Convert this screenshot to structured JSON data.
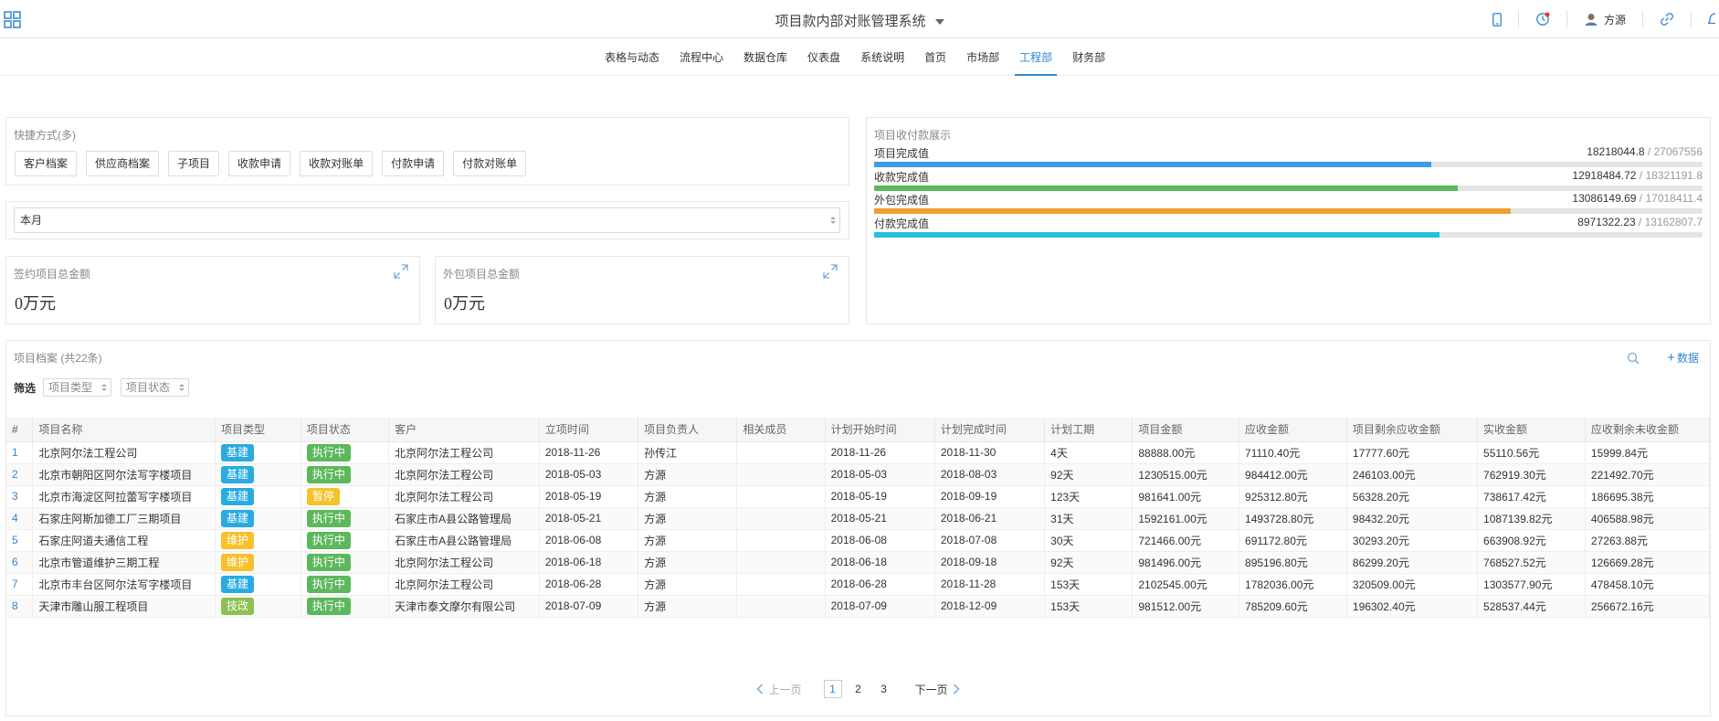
{
  "header": {
    "title": "项目款内部对账管理系统",
    "user_name": "方源"
  },
  "nav": {
    "tabs": [
      "表格与动态",
      "流程中心",
      "数据仓库",
      "仪表盘",
      "系统说明",
      "首页",
      "市场部",
      "工程部",
      "财务部"
    ],
    "active_tab": "工程部"
  },
  "shortcuts": {
    "title": "快捷方式(多)",
    "buttons": [
      "客户档案",
      "供应商档案",
      "子项目",
      "收款申请",
      "收款对账单",
      "付款申请",
      "付款对账单"
    ]
  },
  "period": {
    "value": "本月"
  },
  "kpis": [
    {
      "title": "签约项目总金额",
      "value": "0万元"
    },
    {
      "title": "外包项目总金额",
      "value": "0万元"
    }
  ],
  "progress": {
    "title": "项目收付款展示",
    "items": [
      {
        "label": "项目完成值",
        "value": "18218044.8",
        "total": "27067556",
        "fraction": 0.673,
        "color": "#3b9ce8"
      },
      {
        "label": "收款完成值",
        "value": "12918484.72",
        "total": "18321191.8",
        "fraction": 0.705,
        "color": "#5cb85c"
      },
      {
        "label": "外包完成值",
        "value": "13086149.69",
        "total": "17018411.4",
        "fraction": 0.769,
        "color": "#f0a030"
      },
      {
        "label": "付款完成值",
        "value": "8971322.23",
        "total": "13162807.7",
        "fraction": 0.682,
        "color": "#26c0d8"
      }
    ]
  },
  "table": {
    "title": "项目档案 (共22条)",
    "add_label": "数据",
    "filter_label": "筛选",
    "filters": [
      "项目类型",
      "项目状态"
    ],
    "columns": [
      "#",
      "项目名称",
      "项目类型",
      "项目状态",
      "客户",
      "立项时间",
      "项目负责人",
      "相关成员",
      "计划开始时间",
      "计划完成时间",
      "计划工期",
      "项目金额",
      "应收金额",
      "项目剩余应收金额",
      "实收金额",
      "应收剩余未收金额"
    ],
    "type_colors": {
      "基建": "#29abe2",
      "维护": "#f6c12a",
      "技改": "#8cc152"
    },
    "status_colors": {
      "执行中": "#5cb85c",
      "暂停": "#f6c12a"
    },
    "rows": [
      [
        "1",
        "北京阿尔法工程公司",
        "基建",
        "执行中",
        "北京阿尔法工程公司",
        "2018-11-26",
        "孙传江",
        "",
        "2018-11-26",
        "2018-11-30",
        "4天",
        "88888.00元",
        "71110.40元",
        "17777.60元",
        "55110.56元",
        "15999.84元"
      ],
      [
        "2",
        "北京市朝阳区阿尔法写字楼项目",
        "基建",
        "执行中",
        "北京阿尔法工程公司",
        "2018-05-03",
        "方源",
        "",
        "2018-05-03",
        "2018-08-03",
        "92天",
        "1230515.00元",
        "984412.00元",
        "246103.00元",
        "762919.30元",
        "221492.70元"
      ],
      [
        "3",
        "北京市海淀区阿拉蕾写字楼项目",
        "基建",
        "暂停",
        "北京阿尔法工程公司",
        "2018-05-19",
        "方源",
        "",
        "2018-05-19",
        "2018-09-19",
        "123天",
        "981641.00元",
        "925312.80元",
        "56328.20元",
        "738617.42元",
        "186695.38元"
      ],
      [
        "4",
        "石家庄阿斯加德工厂三期项目",
        "基建",
        "执行中",
        "石家庄市A县公路管理局",
        "2018-05-21",
        "方源",
        "",
        "2018-05-21",
        "2018-06-21",
        "31天",
        "1592161.00元",
        "1493728.80元",
        "98432.20元",
        "1087139.82元",
        "406588.98元"
      ],
      [
        "5",
        "石家庄阿道夫通信工程",
        "维护",
        "执行中",
        "石家庄市A县公路管理局",
        "2018-06-08",
        "方源",
        "",
        "2018-06-08",
        "2018-07-08",
        "30天",
        "721466.00元",
        "691172.80元",
        "30293.20元",
        "663908.92元",
        "27263.88元"
      ],
      [
        "6",
        "北京市管道维护三期工程",
        "维护",
        "执行中",
        "北京阿尔法工程公司",
        "2018-06-18",
        "方源",
        "",
        "2018-06-18",
        "2018-09-18",
        "92天",
        "981496.00元",
        "895196.80元",
        "86299.20元",
        "768527.52元",
        "126669.28元"
      ],
      [
        "7",
        "北京市丰台区阿尔法写字楼项目",
        "基建",
        "执行中",
        "北京阿尔法工程公司",
        "2018-06-28",
        "方源",
        "",
        "2018-06-28",
        "2018-11-28",
        "153天",
        "2102545.00元",
        "1782036.00元",
        "320509.00元",
        "1303577.90元",
        "478458.10元"
      ],
      [
        "8",
        "天津市雕山服工程项目",
        "技改",
        "执行中",
        "天津市泰文摩尔有限公司",
        "2018-07-09",
        "方源",
        "",
        "2018-07-09",
        "2018-12-09",
        "153天",
        "981512.00元",
        "785209.60元",
        "196302.40元",
        "528537.44元",
        "256672.16元"
      ]
    ]
  },
  "pagination": {
    "prev_label": "上一页",
    "next_label": "下一页",
    "pages": [
      "1",
      "2",
      "3"
    ],
    "current": "1"
  }
}
